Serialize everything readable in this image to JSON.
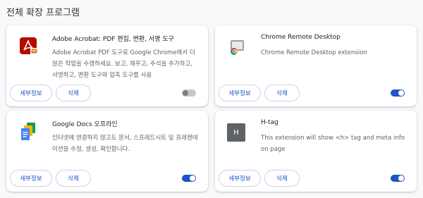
{
  "page": {
    "title": "전체 확장 프로그램"
  },
  "buttons": {
    "details": "세부정보",
    "remove": "삭제"
  },
  "extensions": [
    {
      "name": "Adobe Acrobat: PDF 편집, 변환, 서명 도구",
      "description": "Adobe Acrobat PDF 도구로 Google Chrome에서 더 많은 작업을 수행하세요. 보고, 채우고, 주석을 추가하고, 서명하고, 변환 도구와 압축 도구를 사용",
      "icon": "adobe-acrobat-icon",
      "enabled": false
    },
    {
      "name": "Chrome Remote Desktop",
      "description": "Chrome Remote Desktop extension",
      "icon": "chrome-remote-desktop-icon",
      "enabled": true
    },
    {
      "name": "Google Docs 오프라인",
      "description": "인터넷에 연결하지 않고도 문서, 스프레드시트 및 프레젠테이션을 수정, 생성, 확인합니다.",
      "icon": "google-docs-offline-icon",
      "enabled": true
    },
    {
      "name": "H-tag",
      "description": "This extension will show <h> tag and meta info on page",
      "icon": "h-tag-icon",
      "icon_letter": "H",
      "enabled": true
    }
  ]
}
